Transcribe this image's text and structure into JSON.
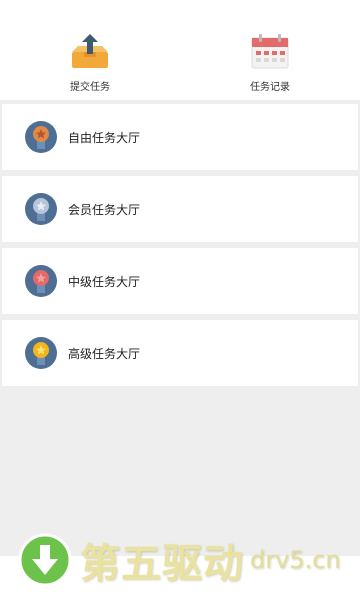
{
  "top_actions": {
    "submit": {
      "label": "提交任务",
      "icon": "upload-tray-icon"
    },
    "records": {
      "label": "任务记录",
      "icon": "calendar-icon"
    }
  },
  "halls": [
    {
      "label": "自由任务大厅",
      "icon": "bronze-star-medal-icon",
      "color": "#e0894a"
    },
    {
      "label": "会员任务大厅",
      "icon": "silver-star-medal-icon",
      "color": "#b7c4da"
    },
    {
      "label": "中级任务大厅",
      "icon": "red-star-medal-icon",
      "color": "#e26a6a"
    },
    {
      "label": "高级任务大厅",
      "icon": "gold-star-medal-icon",
      "color": "#f2b51c"
    }
  ],
  "watermark": {
    "text": "第五驱动",
    "domain": "drv5.cn",
    "badge_color": "#6cc24a"
  }
}
